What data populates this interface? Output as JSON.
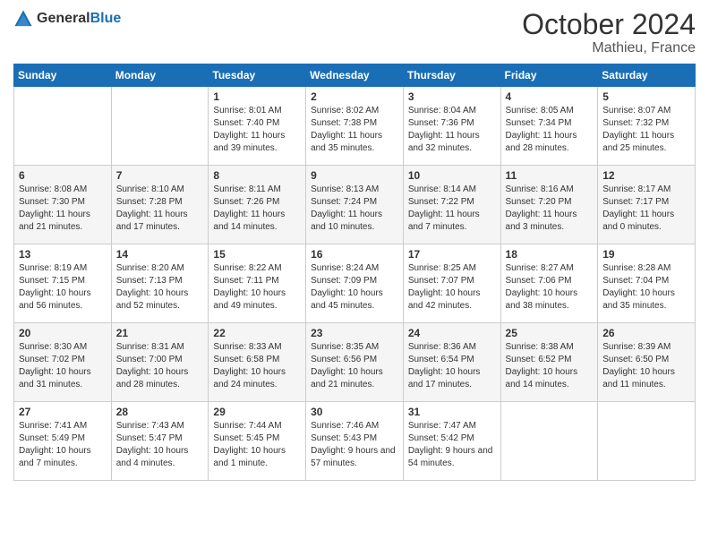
{
  "header": {
    "logo_general": "General",
    "logo_blue": "Blue",
    "month": "October 2024",
    "location": "Mathieu, France"
  },
  "days_of_week": [
    "Sunday",
    "Monday",
    "Tuesday",
    "Wednesday",
    "Thursday",
    "Friday",
    "Saturday"
  ],
  "weeks": [
    [
      {
        "num": "",
        "info": ""
      },
      {
        "num": "",
        "info": ""
      },
      {
        "num": "1",
        "info": "Sunrise: 8:01 AM\nSunset: 7:40 PM\nDaylight: 11 hours and 39 minutes."
      },
      {
        "num": "2",
        "info": "Sunrise: 8:02 AM\nSunset: 7:38 PM\nDaylight: 11 hours and 35 minutes."
      },
      {
        "num": "3",
        "info": "Sunrise: 8:04 AM\nSunset: 7:36 PM\nDaylight: 11 hours and 32 minutes."
      },
      {
        "num": "4",
        "info": "Sunrise: 8:05 AM\nSunset: 7:34 PM\nDaylight: 11 hours and 28 minutes."
      },
      {
        "num": "5",
        "info": "Sunrise: 8:07 AM\nSunset: 7:32 PM\nDaylight: 11 hours and 25 minutes."
      }
    ],
    [
      {
        "num": "6",
        "info": "Sunrise: 8:08 AM\nSunset: 7:30 PM\nDaylight: 11 hours and 21 minutes."
      },
      {
        "num": "7",
        "info": "Sunrise: 8:10 AM\nSunset: 7:28 PM\nDaylight: 11 hours and 17 minutes."
      },
      {
        "num": "8",
        "info": "Sunrise: 8:11 AM\nSunset: 7:26 PM\nDaylight: 11 hours and 14 minutes."
      },
      {
        "num": "9",
        "info": "Sunrise: 8:13 AM\nSunset: 7:24 PM\nDaylight: 11 hours and 10 minutes."
      },
      {
        "num": "10",
        "info": "Sunrise: 8:14 AM\nSunset: 7:22 PM\nDaylight: 11 hours and 7 minutes."
      },
      {
        "num": "11",
        "info": "Sunrise: 8:16 AM\nSunset: 7:20 PM\nDaylight: 11 hours and 3 minutes."
      },
      {
        "num": "12",
        "info": "Sunrise: 8:17 AM\nSunset: 7:17 PM\nDaylight: 11 hours and 0 minutes."
      }
    ],
    [
      {
        "num": "13",
        "info": "Sunrise: 8:19 AM\nSunset: 7:15 PM\nDaylight: 10 hours and 56 minutes."
      },
      {
        "num": "14",
        "info": "Sunrise: 8:20 AM\nSunset: 7:13 PM\nDaylight: 10 hours and 52 minutes."
      },
      {
        "num": "15",
        "info": "Sunrise: 8:22 AM\nSunset: 7:11 PM\nDaylight: 10 hours and 49 minutes."
      },
      {
        "num": "16",
        "info": "Sunrise: 8:24 AM\nSunset: 7:09 PM\nDaylight: 10 hours and 45 minutes."
      },
      {
        "num": "17",
        "info": "Sunrise: 8:25 AM\nSunset: 7:07 PM\nDaylight: 10 hours and 42 minutes."
      },
      {
        "num": "18",
        "info": "Sunrise: 8:27 AM\nSunset: 7:06 PM\nDaylight: 10 hours and 38 minutes."
      },
      {
        "num": "19",
        "info": "Sunrise: 8:28 AM\nSunset: 7:04 PM\nDaylight: 10 hours and 35 minutes."
      }
    ],
    [
      {
        "num": "20",
        "info": "Sunrise: 8:30 AM\nSunset: 7:02 PM\nDaylight: 10 hours and 31 minutes."
      },
      {
        "num": "21",
        "info": "Sunrise: 8:31 AM\nSunset: 7:00 PM\nDaylight: 10 hours and 28 minutes."
      },
      {
        "num": "22",
        "info": "Sunrise: 8:33 AM\nSunset: 6:58 PM\nDaylight: 10 hours and 24 minutes."
      },
      {
        "num": "23",
        "info": "Sunrise: 8:35 AM\nSunset: 6:56 PM\nDaylight: 10 hours and 21 minutes."
      },
      {
        "num": "24",
        "info": "Sunrise: 8:36 AM\nSunset: 6:54 PM\nDaylight: 10 hours and 17 minutes."
      },
      {
        "num": "25",
        "info": "Sunrise: 8:38 AM\nSunset: 6:52 PM\nDaylight: 10 hours and 14 minutes."
      },
      {
        "num": "26",
        "info": "Sunrise: 8:39 AM\nSunset: 6:50 PM\nDaylight: 10 hours and 11 minutes."
      }
    ],
    [
      {
        "num": "27",
        "info": "Sunrise: 7:41 AM\nSunset: 5:49 PM\nDaylight: 10 hours and 7 minutes."
      },
      {
        "num": "28",
        "info": "Sunrise: 7:43 AM\nSunset: 5:47 PM\nDaylight: 10 hours and 4 minutes."
      },
      {
        "num": "29",
        "info": "Sunrise: 7:44 AM\nSunset: 5:45 PM\nDaylight: 10 hours and 1 minute."
      },
      {
        "num": "30",
        "info": "Sunrise: 7:46 AM\nSunset: 5:43 PM\nDaylight: 9 hours and 57 minutes."
      },
      {
        "num": "31",
        "info": "Sunrise: 7:47 AM\nSunset: 5:42 PM\nDaylight: 9 hours and 54 minutes."
      },
      {
        "num": "",
        "info": ""
      },
      {
        "num": "",
        "info": ""
      }
    ]
  ]
}
